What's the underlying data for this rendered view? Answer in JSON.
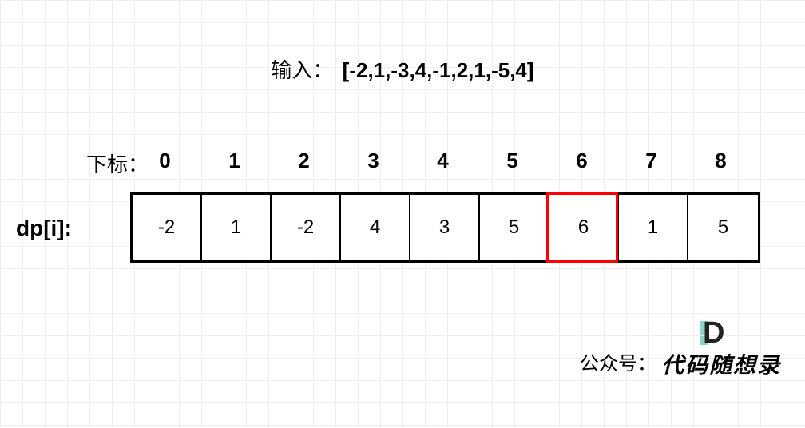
{
  "input": {
    "label": "输入：",
    "array_text": "[-2,1,-3,4,-1,2,1,-5,4]"
  },
  "index": {
    "label": "下标：",
    "values": [
      "0",
      "1",
      "2",
      "3",
      "4",
      "5",
      "6",
      "7",
      "8"
    ]
  },
  "dp": {
    "label": "dp[i]:",
    "values": [
      "-2",
      "1",
      "-2",
      "4",
      "3",
      "5",
      "6",
      "1",
      "5"
    ],
    "highlight_index": 6
  },
  "footer": {
    "label": "公众号：",
    "brand": "代码随想录"
  },
  "chart_data": {
    "type": "table",
    "title": "Maximum subarray DP table",
    "input_array": [
      -2,
      1,
      -3,
      4,
      -1,
      2,
      1,
      -5,
      4
    ],
    "indices": [
      0,
      1,
      2,
      3,
      4,
      5,
      6,
      7,
      8
    ],
    "dp_values": [
      -2,
      1,
      -2,
      4,
      3,
      5,
      6,
      1,
      5
    ],
    "highlighted_index": 6,
    "highlighted_value": 6
  }
}
